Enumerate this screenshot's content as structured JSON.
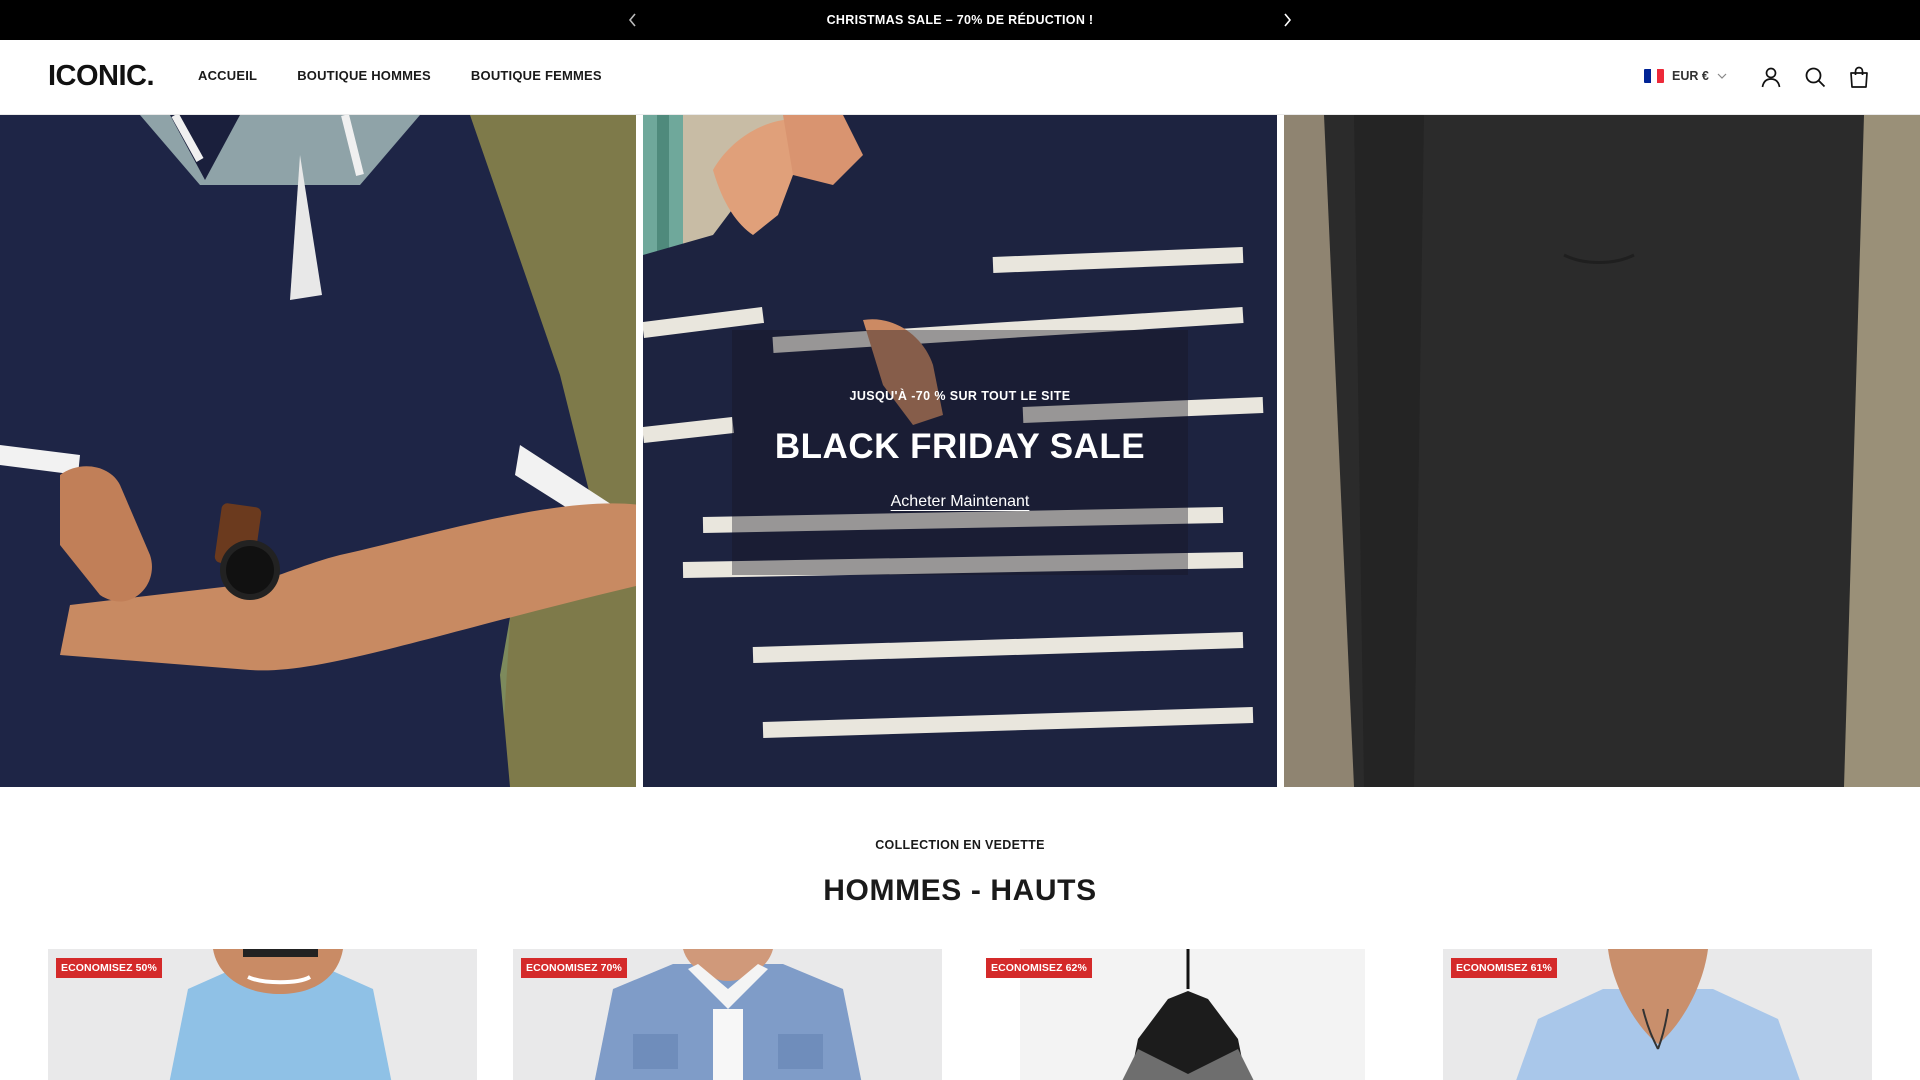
{
  "announcement": {
    "text": "CHRISTMAS SALE – 70% DE RÉDUCTION !",
    "prev_icon": "chevron-left-icon",
    "next_icon": "chevron-right-icon"
  },
  "header": {
    "logo": "ICONIC.",
    "nav": [
      "ACCUEIL",
      "BOUTIQUE HOMMES",
      "BOUTIQUE FEMMES"
    ],
    "currency": "EUR €",
    "flag_colors": [
      "#002395",
      "#ffffff",
      "#ed2939"
    ],
    "icons": [
      "account-icon",
      "search-icon",
      "cart-icon"
    ]
  },
  "hero": {
    "eyebrow": "JUSQU'À -70 % SUR TOUT LE SITE",
    "title": "BLACK FRIDAY SALE",
    "cta": "Acheter Maintenant"
  },
  "featured": {
    "eyebrow": "COLLECTION EN VEDETTE",
    "title": "HOMMES - HAUTS",
    "products": [
      {
        "badge": "ECONOMISEZ 50%"
      },
      {
        "badge": "ECONOMISEZ 70%"
      },
      {
        "badge": "ECONOMISEZ 62%"
      },
      {
        "badge": "ECONOMISEZ 61%"
      }
    ]
  },
  "colors": {
    "announcement_bg": "#000000",
    "badge_bg": "#d42a2a",
    "navy": "#1e2546",
    "charcoal": "#2a2a2a"
  }
}
